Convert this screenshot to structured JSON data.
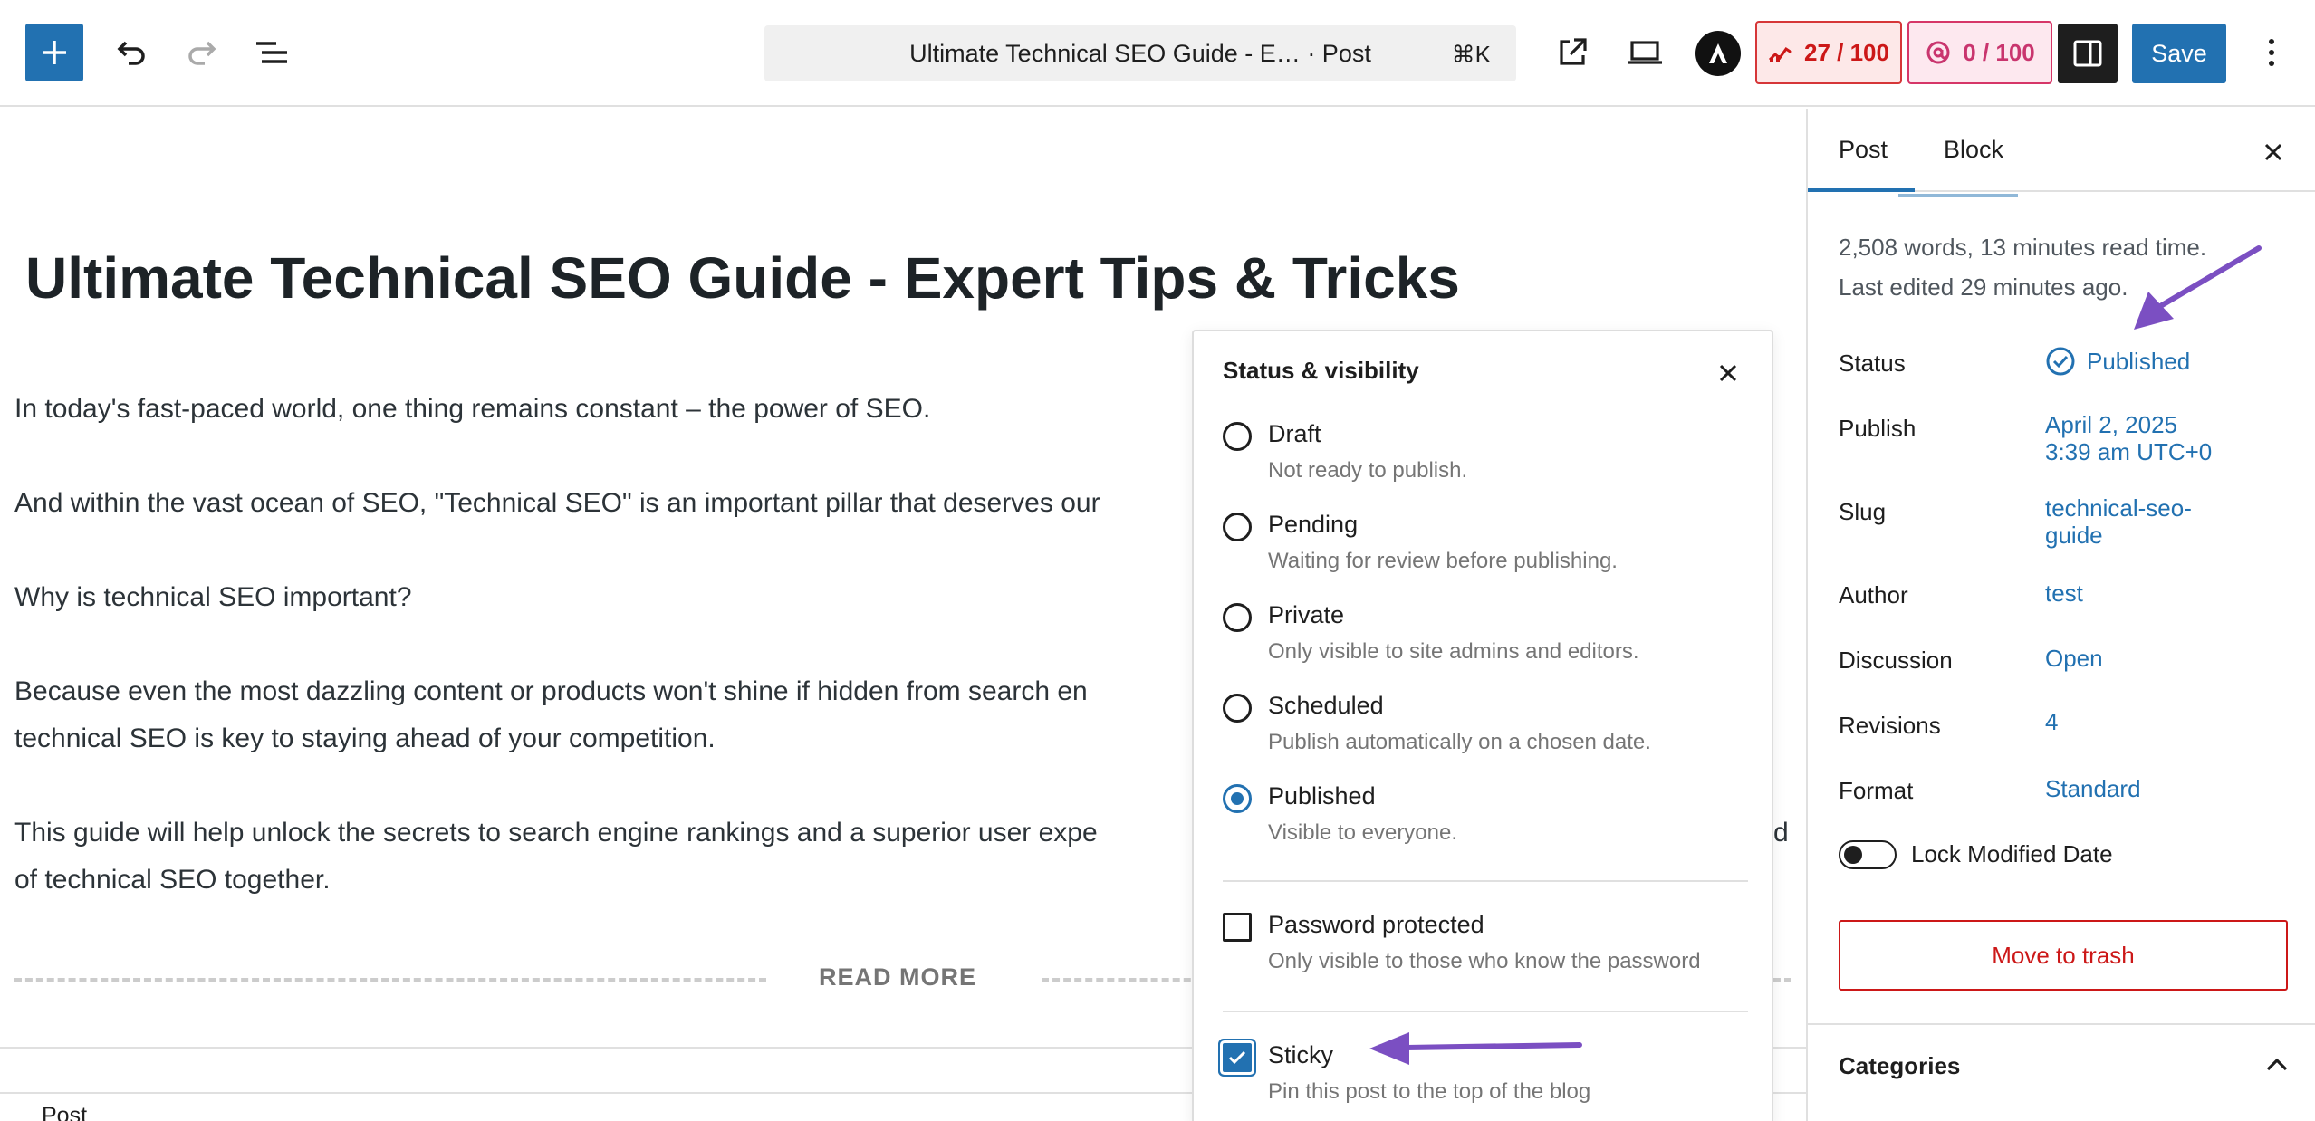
{
  "toolbar": {
    "command_bar_title": "Ultimate Technical SEO Guide - E… · Post",
    "command_shortcut": "⌘K",
    "seo_score": "27 / 100",
    "readability_score": "0 / 100",
    "save_label": "Save"
  },
  "post": {
    "title": "Ultimate Technical SEO Guide - Expert Tips & Tricks",
    "paragraphs": {
      "p1": "In today's fast-paced world, one thing remains constant – the power of SEO.",
      "p2": "And within the vast ocean of SEO, \"Technical SEO\" is an important pillar that deserves our",
      "p3": "Why is technical SEO important?",
      "p4a": "Because even the most dazzling content or products won't shine if hidden from search en",
      "p4b": "technical SEO is key to staying ahead of your competition.",
      "p5a": "This guide will help unlock the secrets to search engine rankings and a superior user expe",
      "p5a_tail": "d",
      "p5b": "of technical SEO together."
    },
    "read_more_label": "READ MORE"
  },
  "footer": {
    "breadcrumb": "Post"
  },
  "status_popover": {
    "title": "Status & visibility",
    "options": [
      {
        "label": "Draft",
        "description": "Not ready to publish.",
        "checked": false
      },
      {
        "label": "Pending",
        "description": "Waiting for review before publishing.",
        "checked": false
      },
      {
        "label": "Private",
        "description": "Only visible to site admins and editors.",
        "checked": false
      },
      {
        "label": "Scheduled",
        "description": "Publish automatically on a chosen date.",
        "checked": false
      },
      {
        "label": "Published",
        "description": "Visible to everyone.",
        "checked": true
      }
    ],
    "password_protected": {
      "label": "Password protected",
      "description": "Only visible to those who know the password",
      "checked": false
    },
    "sticky": {
      "label": "Sticky",
      "description": "Pin this post to the top of the blog",
      "checked": true
    }
  },
  "sidebar": {
    "tabs": {
      "post": "Post",
      "block": "Block"
    },
    "word_count": "2,508 words, 13 minutes read time.",
    "last_edited": "Last edited 29 minutes ago.",
    "rows": {
      "status_label": "Status",
      "status_value": "Published",
      "publish_label": "Publish",
      "publish_date": "April 2, 2025",
      "publish_time": "3:39 am UTC+0",
      "slug_label": "Slug",
      "slug_line1": "technical-seo-",
      "slug_line2": "guide",
      "author_label": "Author",
      "author_value": "test",
      "discussion_label": "Discussion",
      "discussion_value": "Open",
      "revisions_label": "Revisions",
      "revisions_value": "4",
      "format_label": "Format",
      "format_value": "Standard"
    },
    "lock_modified_date_label": "Lock Modified Date",
    "lock_modified_date_on": false,
    "trash_label": "Move to trash",
    "categories_title": "Categories"
  },
  "colors": {
    "accent": "#2271b1",
    "danger": "#cc1818",
    "annotation_arrow": "#7b4fc2"
  }
}
